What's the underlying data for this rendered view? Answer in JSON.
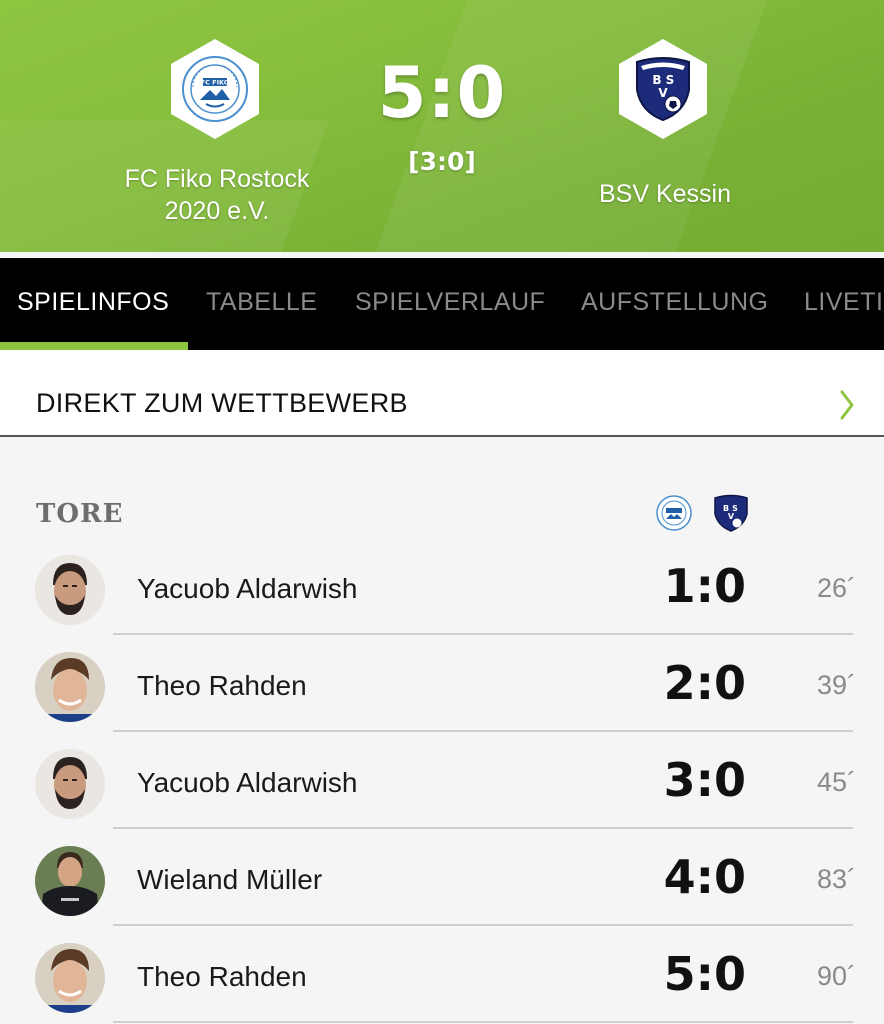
{
  "match": {
    "home_team": "FC Fiko Rostock 2020 e.V.",
    "away_team": "BSV Kessin",
    "score": "5:0",
    "halftime": "[3:0]",
    "home_logo_text": "FC FIKO",
    "away_logo_text": "BSV"
  },
  "tabs": [
    {
      "label": "SPIELINFOS",
      "active": true
    },
    {
      "label": "TABELLE",
      "active": false
    },
    {
      "label": "SPIELVERLAUF",
      "active": false
    },
    {
      "label": "AUFSTELLUNG",
      "active": false
    },
    {
      "label": "LIVETI",
      "active": false
    }
  ],
  "competition_link": {
    "label": "DIREKT ZUM WETTBEWERB",
    "icon": "chevron-right-icon"
  },
  "goals": {
    "title": "TORE",
    "items": [
      {
        "player": "Yacuob Aldarwish",
        "score": "1:0",
        "minute": "26´"
      },
      {
        "player": "Theo Rahden",
        "score": "2:0",
        "minute": "39´"
      },
      {
        "player": "Yacuob Aldarwish",
        "score": "3:0",
        "minute": "45´"
      },
      {
        "player": "Wieland Müller",
        "score": "4:0",
        "minute": "83´"
      },
      {
        "player": "Theo Rahden",
        "score": "5:0",
        "minute": "90´"
      }
    ]
  },
  "colors": {
    "accent": "#8cc63f",
    "header_green": "#7fb839",
    "tab_bar": "#000000",
    "away_blue": "#1d2c7a"
  }
}
